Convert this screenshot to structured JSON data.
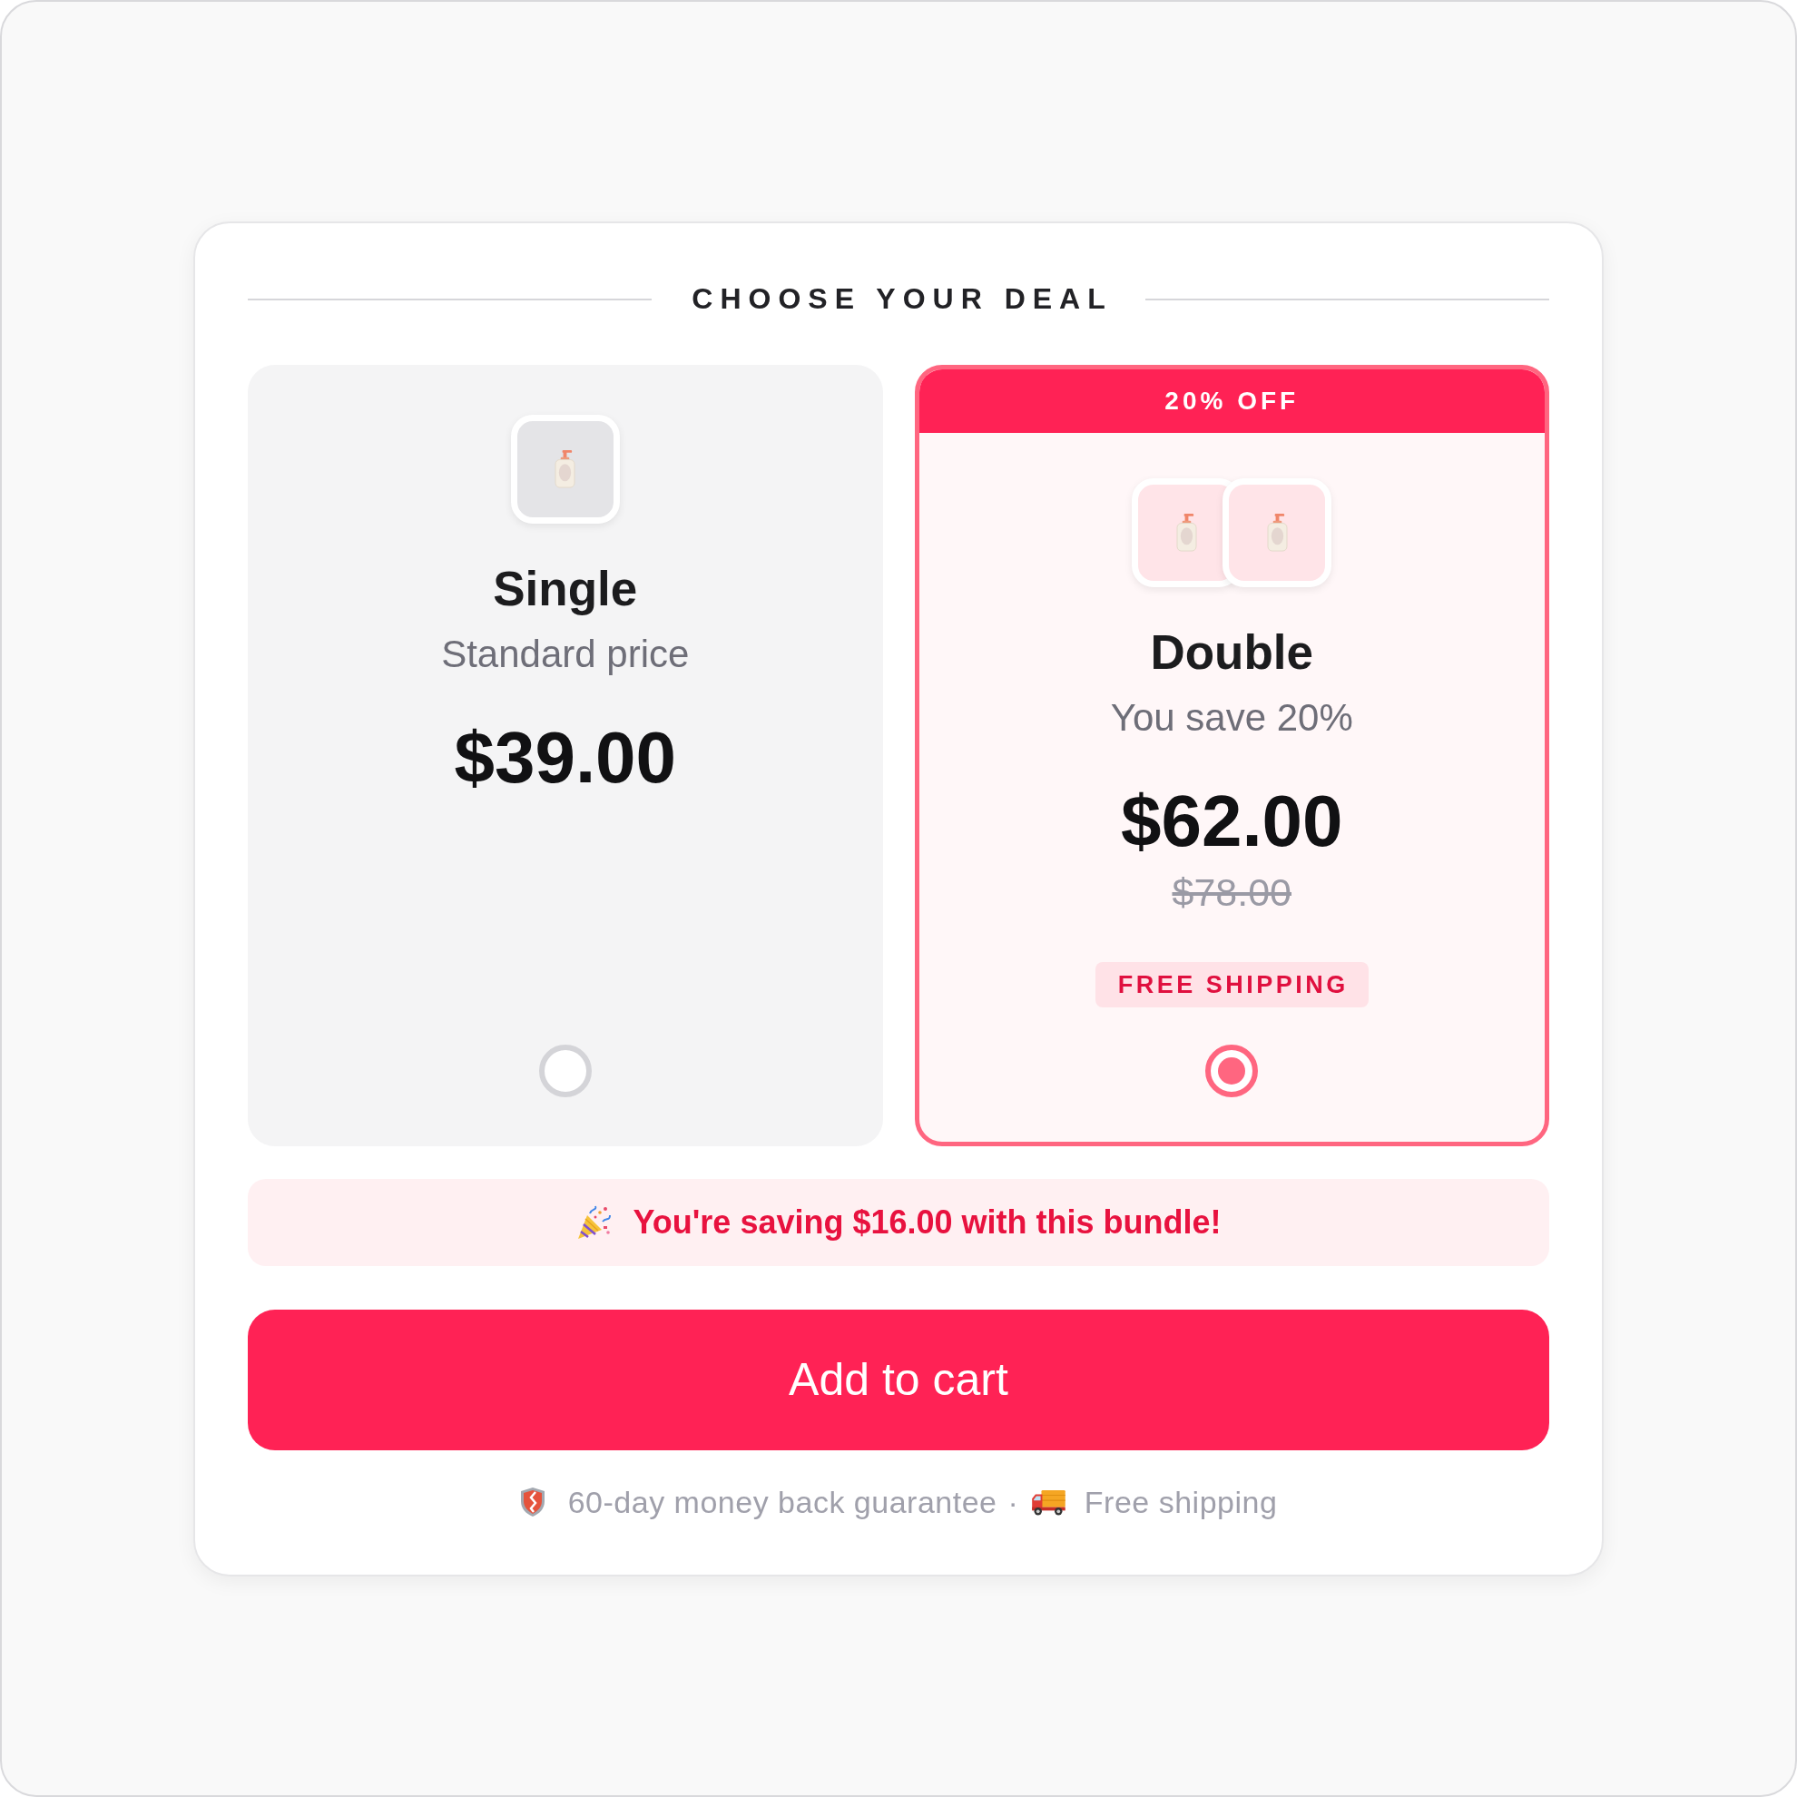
{
  "heading": "CHOOSE YOUR DEAL",
  "options": [
    {
      "title": "Single",
      "subtitle": "Standard price",
      "price": "$39.00",
      "products": [
        {
          "kind": "bottle"
        }
      ],
      "selected": false
    },
    {
      "ribbon": "20% OFF",
      "title": "Double",
      "subtitle": "You save 20%",
      "price": "$62.00",
      "original_price": "$78.00",
      "badge": "FREE SHIPPING",
      "products": [
        {
          "kind": "bottle"
        },
        {
          "kind": "bottle"
        }
      ],
      "selected": true
    }
  ],
  "savings_banner": {
    "text": "You're saving $16.00 with this bundle!"
  },
  "add_to_cart": {
    "label": "Add to cart"
  },
  "footer": {
    "items": [
      {
        "kind": "guarantee",
        "text": "60-day money back guarantee"
      },
      {
        "kind": "shipping",
        "text": "Free shipping"
      }
    ],
    "separator": "·"
  }
}
